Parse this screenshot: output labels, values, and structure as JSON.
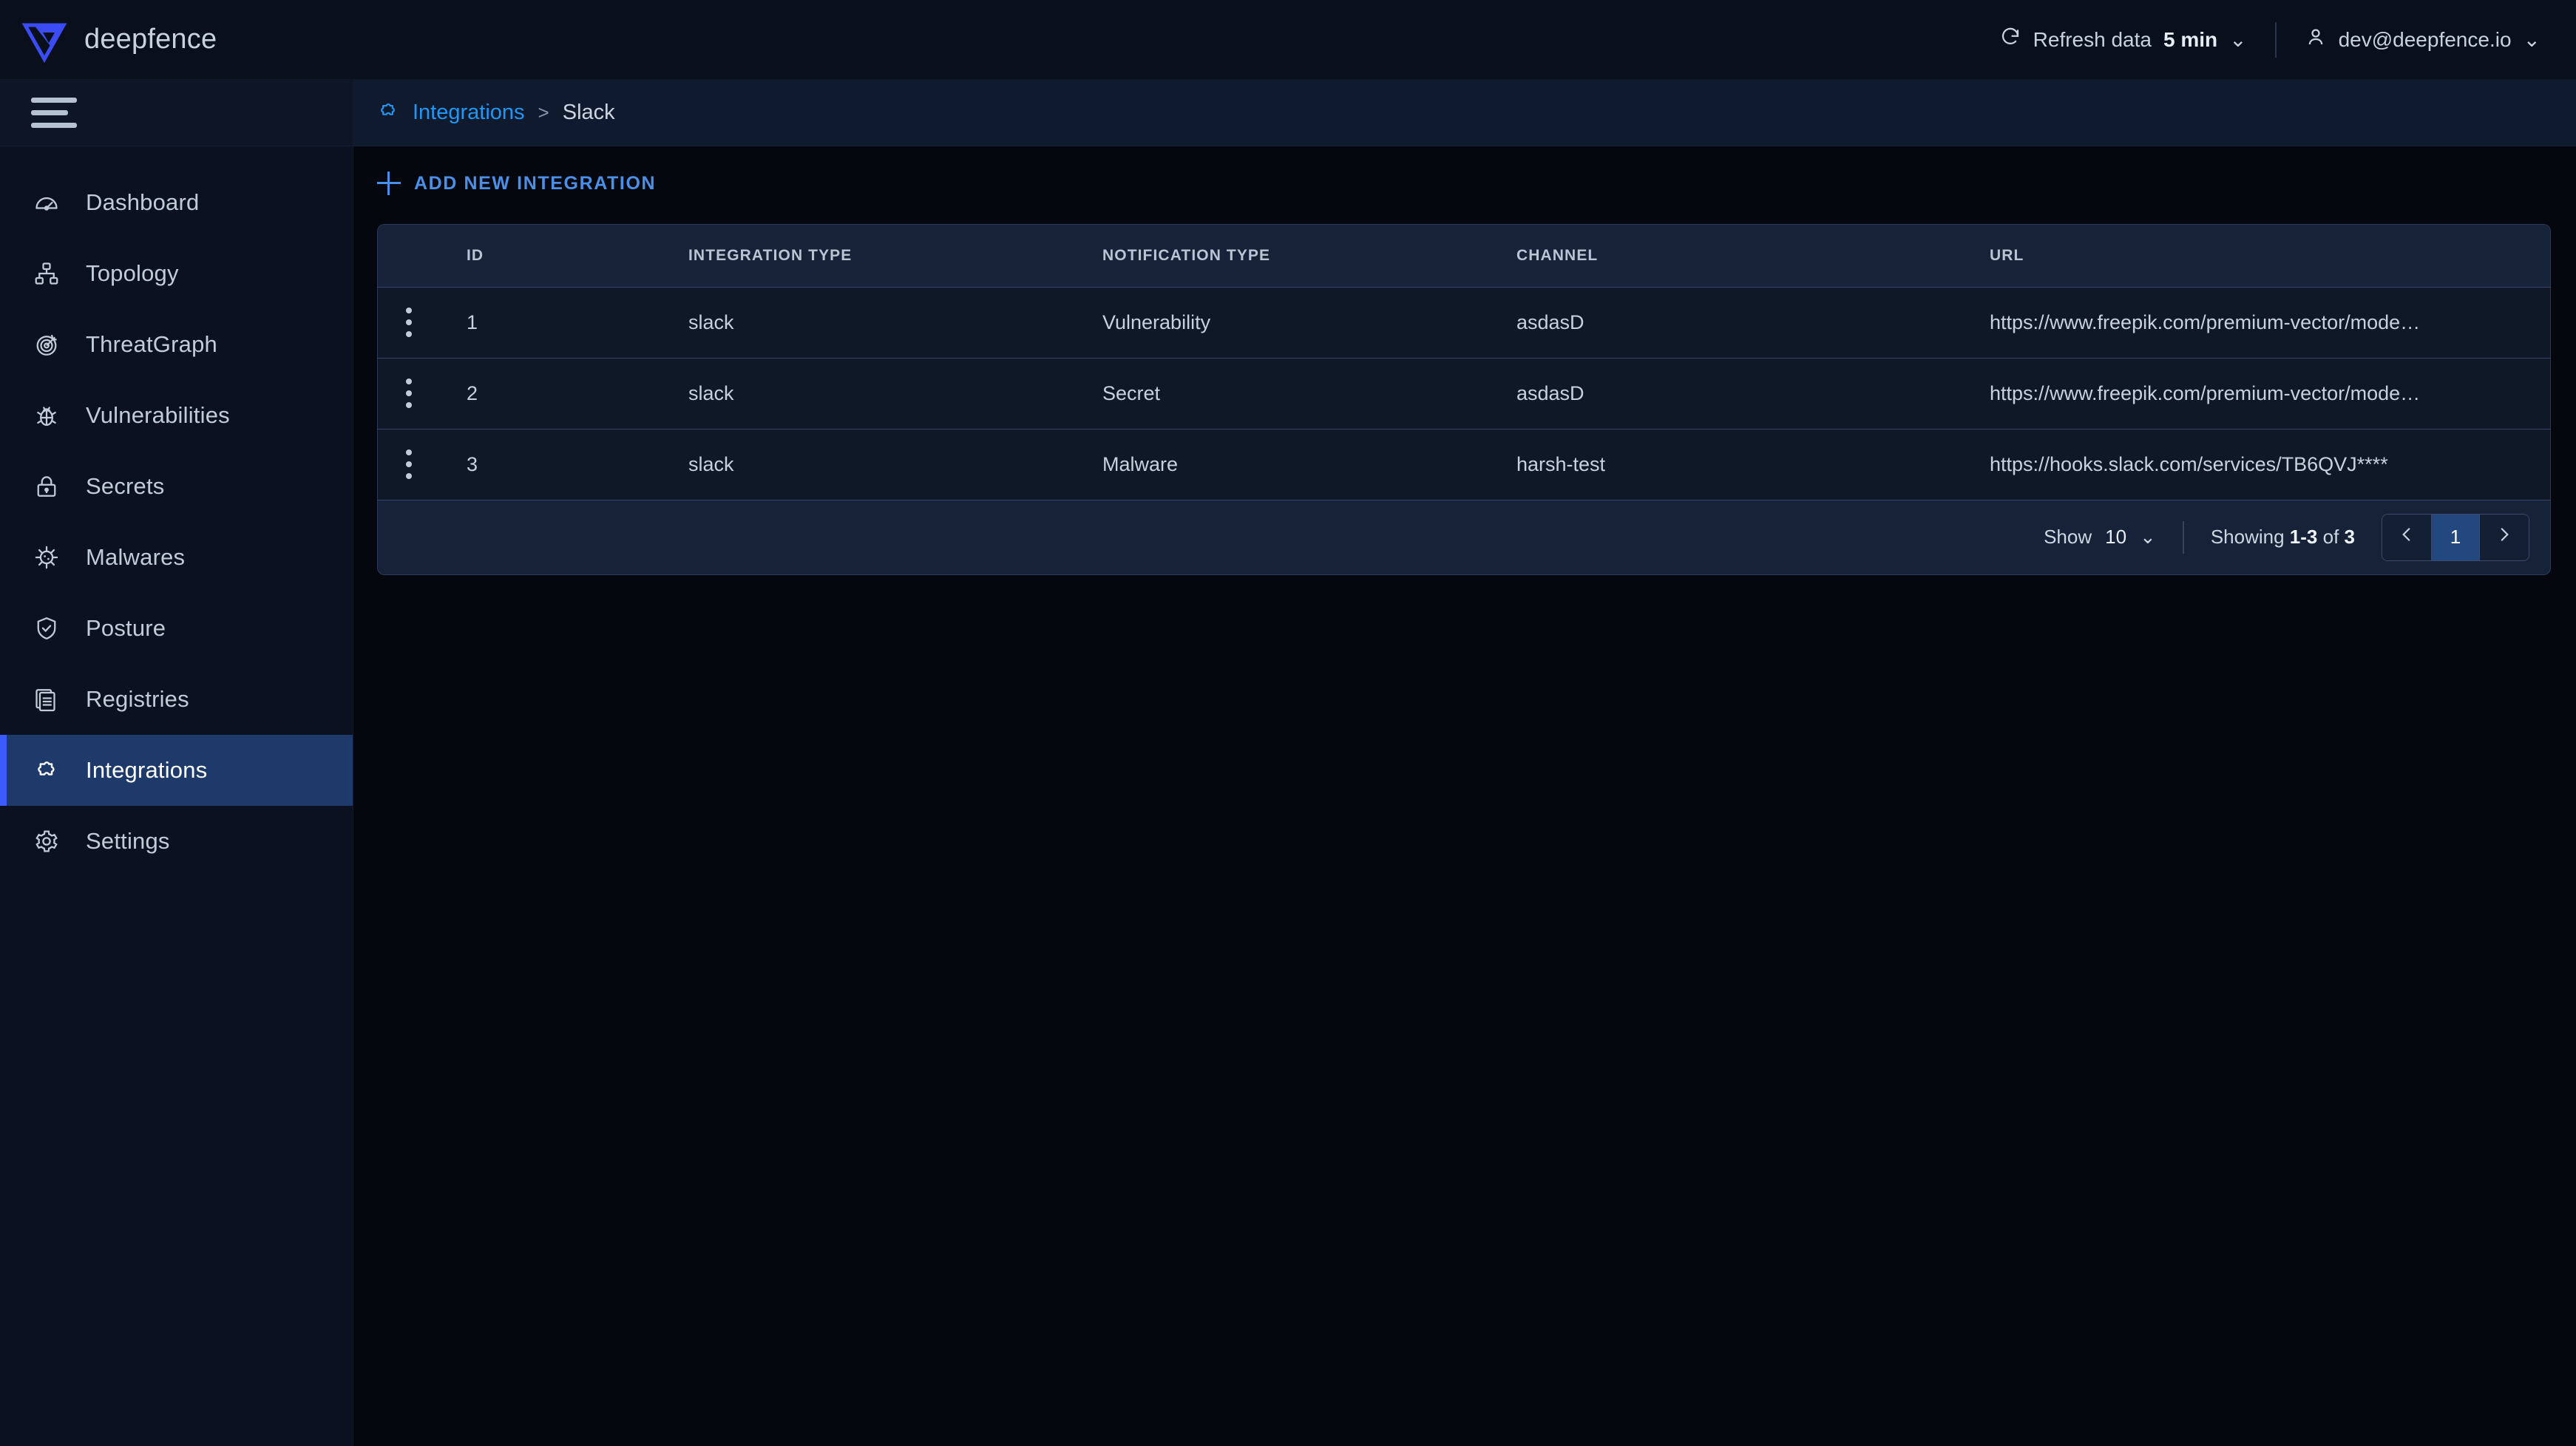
{
  "header": {
    "brand": "deepfence",
    "brand_logo_icon": "deepfence-logo-icon",
    "refresh_icon": "refresh-icon",
    "refresh_label": "Refresh data",
    "refresh_value": "5 min",
    "refresh_chevron": "⌄",
    "user_icon": "user-icon",
    "user_email": "dev@deepfence.io",
    "user_chevron": "⌄"
  },
  "sidebar": {
    "menu_icon": "hamburger-menu-icon",
    "items": [
      {
        "label": "Dashboard",
        "icon": "gauge-icon",
        "active": false
      },
      {
        "label": "Topology",
        "icon": "topology-icon",
        "active": false
      },
      {
        "label": "ThreatGraph",
        "icon": "target-icon",
        "active": false
      },
      {
        "label": "Vulnerabilities",
        "icon": "bug-icon",
        "active": false
      },
      {
        "label": "Secrets",
        "icon": "lock-icon",
        "active": false
      },
      {
        "label": "Malwares",
        "icon": "virus-icon",
        "active": false
      },
      {
        "label": "Posture",
        "icon": "shield-check-icon",
        "active": false
      },
      {
        "label": "Registries",
        "icon": "documents-icon",
        "active": false
      },
      {
        "label": "Integrations",
        "icon": "puzzle-icon",
        "active": true
      },
      {
        "label": "Settings",
        "icon": "gear-icon",
        "active": false
      }
    ]
  },
  "breadcrumb": {
    "icon": "puzzle-icon",
    "link": "Integrations",
    "separator": ">",
    "current": "Slack"
  },
  "toolbar": {
    "add_icon": "plus-icon",
    "add_label": "ADD NEW INTEGRATION"
  },
  "table": {
    "columns": [
      "",
      "ID",
      "INTEGRATION TYPE",
      "NOTIFICATION TYPE",
      "CHANNEL",
      "URL"
    ],
    "rows": [
      {
        "id": "1",
        "integration_type": "slack",
        "notification_type": "Vulnerability",
        "channel": "asdasD",
        "url": "https://www.freepik.com/premium-vector/mode…"
      },
      {
        "id": "2",
        "integration_type": "slack",
        "notification_type": "Secret",
        "channel": "asdasD",
        "url": "https://www.freepik.com/premium-vector/mode…"
      },
      {
        "id": "3",
        "integration_type": "slack",
        "notification_type": "Malware",
        "channel": "harsh-test",
        "url": "https://hooks.slack.com/services/TB6QVJ****"
      }
    ],
    "row_menu_icon": "kebab-menu-icon"
  },
  "pagination": {
    "show_label": "Show",
    "show_value": "10",
    "show_chevron": "⌄",
    "showing_prefix": "Showing",
    "showing_range": "1-3",
    "showing_middle": "of",
    "showing_total": "3",
    "prev_icon": "chevron-left-icon",
    "current_page": "1",
    "next_icon": "chevron-right-icon"
  },
  "colors": {
    "accent_blue": "#3b5bfd",
    "link_blue": "#2196f3",
    "action_blue": "#4a90e8",
    "active_bg": "#1e3a6b",
    "page_bg": "#05070f",
    "panel_bg": "#0f1827",
    "header_bg": "#152238"
  }
}
